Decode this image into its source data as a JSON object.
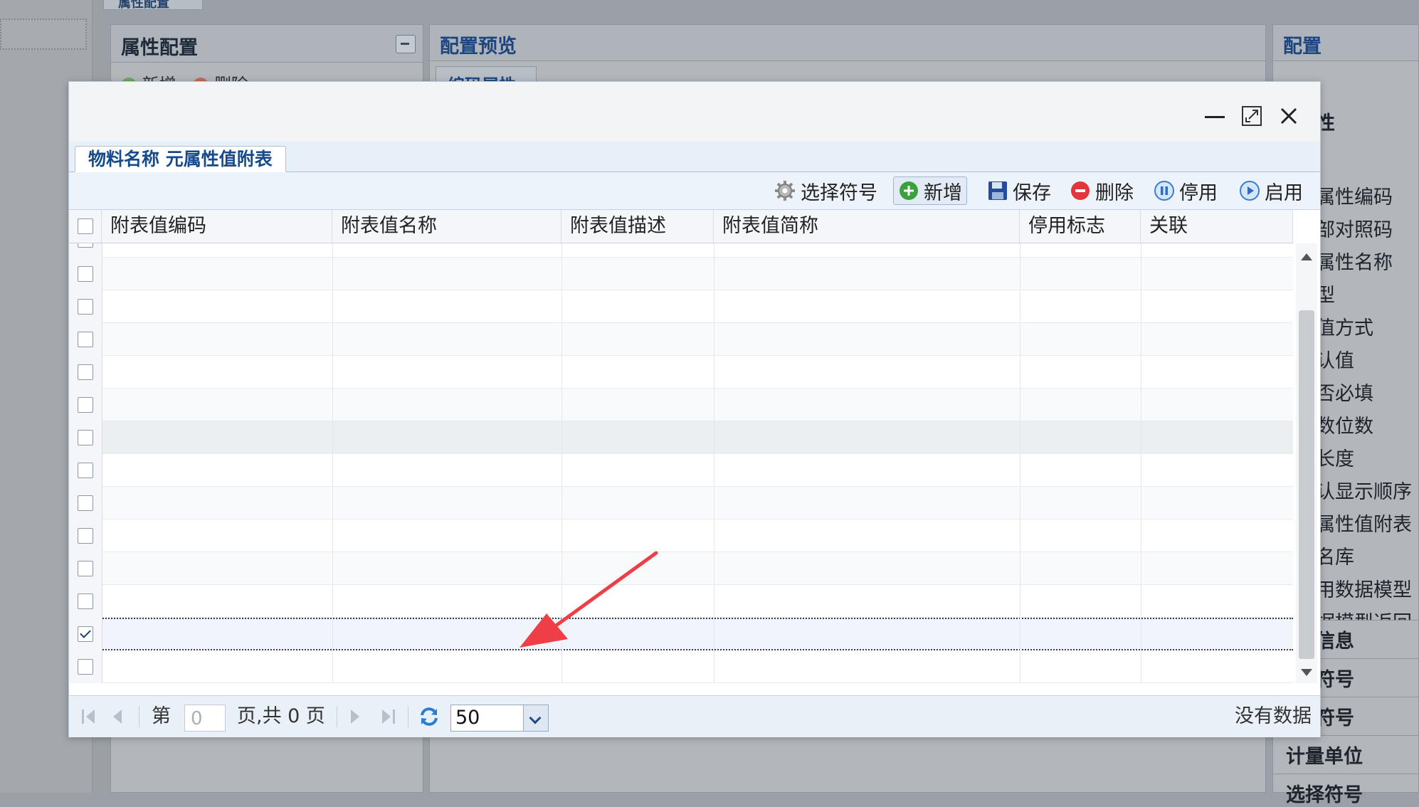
{
  "background": {
    "top_tab": "属性配置",
    "left_panel": {
      "title": "属性配置",
      "buttons": [
        "新增",
        "删除"
      ]
    },
    "center_panel": {
      "title": "配置预览",
      "subtab": "编码属性"
    },
    "right_panel": {
      "title": "配置",
      "items": [
        "性",
        "",
        "属性编码",
        "部对照码",
        "属性名称",
        "型",
        "值方式",
        "认值",
        "否必填",
        "数位数",
        "长度",
        "认显示顺序",
        "属性值附表",
        "名库",
        "用数据模型",
        "据模型返回",
        "信息",
        "符号",
        "符号",
        "计量单位",
        "选择符号"
      ]
    }
  },
  "dialog": {
    "window_buttons": {
      "minimize": "minimize-icon",
      "maximize": "maximize-icon",
      "close": "close-icon"
    },
    "tab_label": "物料名称 元属性值附表",
    "toolbar": {
      "select_symbol": "选择符号",
      "add": "新增",
      "save": "保存",
      "delete": "删除",
      "disable": "停用",
      "enable": "启用"
    },
    "columns": [
      "附表值编码",
      "附表值名称",
      "附表值描述",
      "附表值简称",
      "停用标志",
      "关联"
    ],
    "pager": {
      "page_prefix": "第",
      "page_value": "0",
      "page_suffix": "页,共 0 页",
      "page_size": "50",
      "status": "没有数据"
    }
  },
  "colors": {
    "accent": "#154a8c",
    "annotation_arrow": "#ef3e45"
  }
}
